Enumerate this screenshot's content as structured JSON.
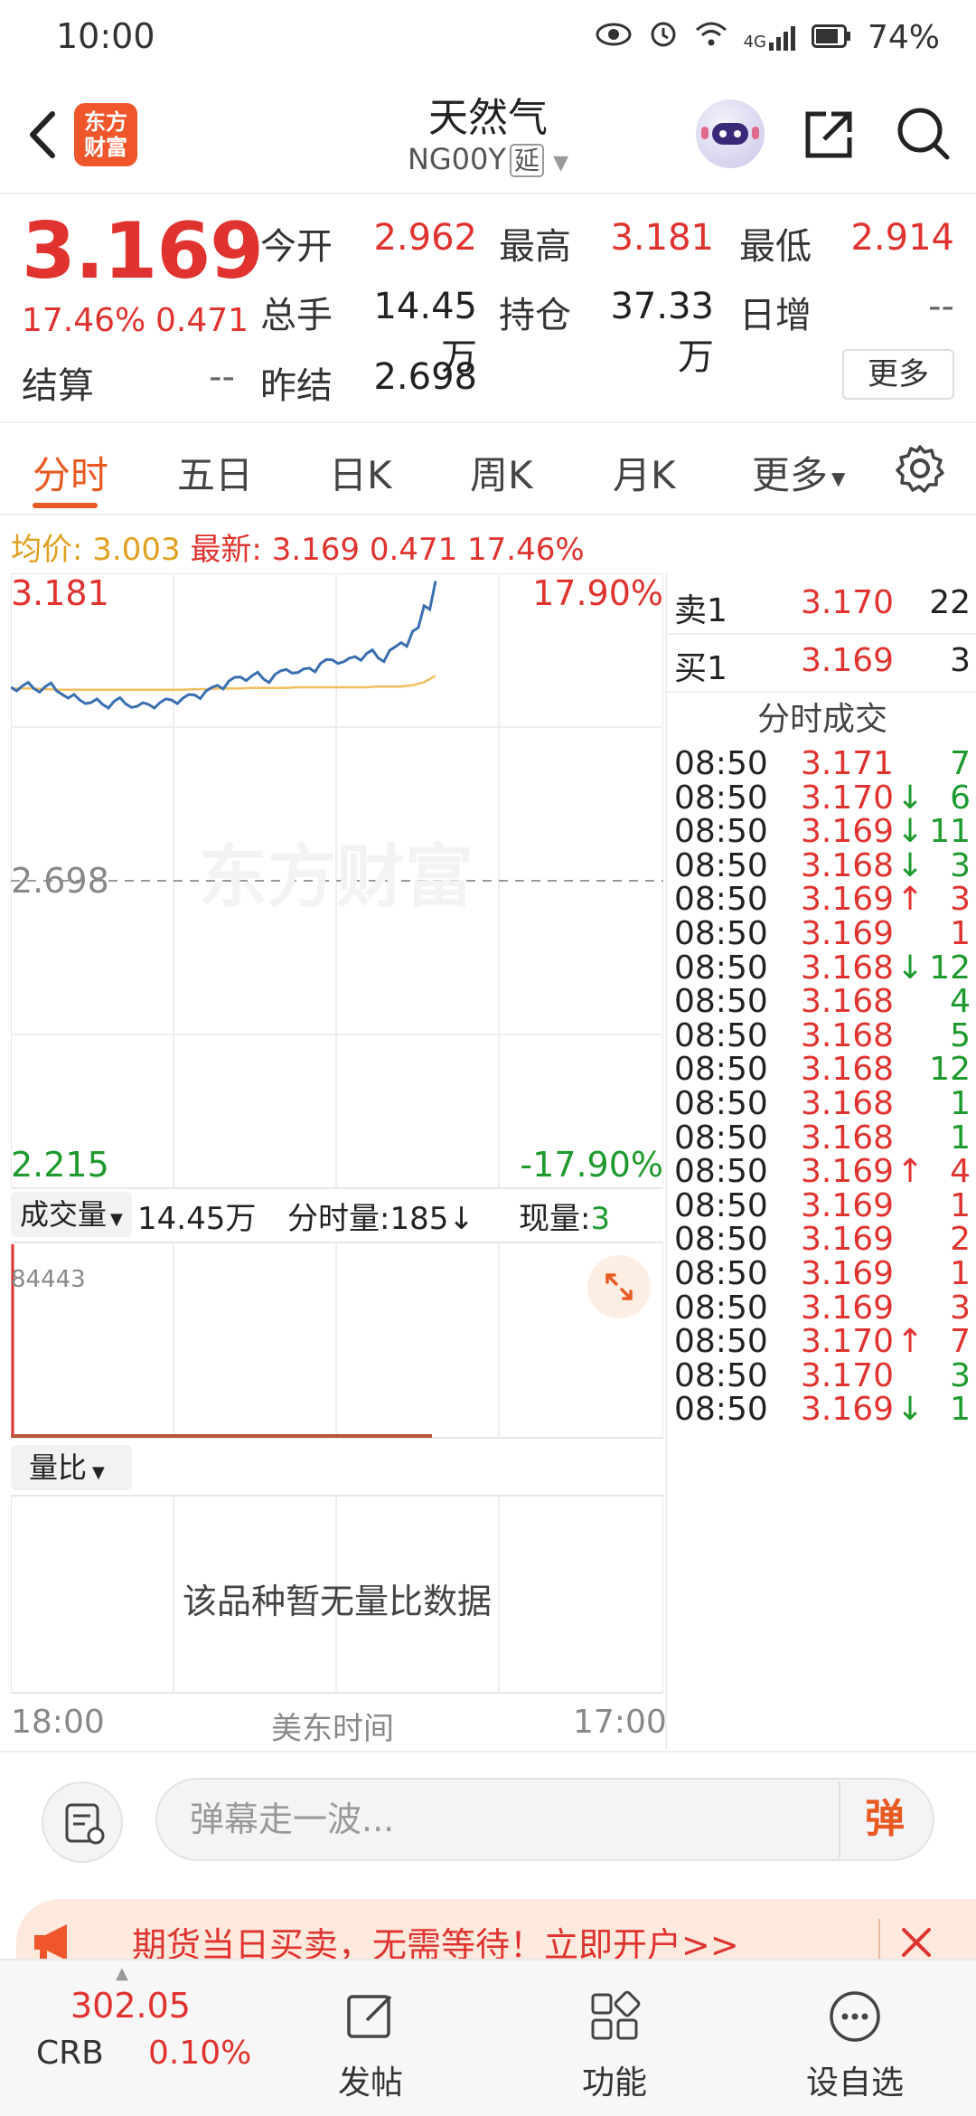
{
  "status_bar": {
    "time": "10:00",
    "network": "4G",
    "battery": "74%"
  },
  "header": {
    "title": "天然气",
    "code": "NG00Y",
    "code_tag": "延",
    "logo_text_1": "东方",
    "logo_text_2": "财富"
  },
  "quote": {
    "price": "3.169",
    "change_pct": "17.46%",
    "change_abs": "0.471",
    "open_label": "今开",
    "open": "2.962",
    "high_label": "最高",
    "high": "3.181",
    "low_label": "最低",
    "low": "2.914",
    "volume_label": "总手",
    "volume": "14.45万",
    "oi_label": "持仓",
    "oi": "37.33万",
    "daily_inc_label": "日增",
    "daily_inc": "--",
    "settle_label": "结算",
    "settle": "--",
    "prev_settle_label": "昨结",
    "prev_settle": "2.698",
    "more": "更多"
  },
  "tabs": [
    "分时",
    "五日",
    "日K",
    "周K",
    "月K",
    "更多"
  ],
  "avg_line": {
    "avg_label": "均价:",
    "avg": "3.003",
    "latest_label": "最新:",
    "latest": "3.169",
    "chg": "0.471",
    "pct": "17.46%"
  },
  "chart": {
    "y_top": "3.181",
    "y_top_pct": "17.90%",
    "y_mid": "2.698",
    "y_bottom": "2.215",
    "y_bottom_pct": "-17.90%",
    "watermark": "东方财富",
    "vol_dropdown": "成交量",
    "vol_total": "14.45万",
    "vol_minute_label": "分时量:",
    "vol_minute": "185",
    "vol_now_label": "现量:",
    "vol_now": "3",
    "vol_max": "84443",
    "ratio_dropdown": "量比",
    "ratio_empty": "该品种暂无量比数据",
    "time_start": "18:00",
    "time_zone": "美东时间",
    "time_end": "17:00"
  },
  "chart_data": {
    "type": "line",
    "title": "",
    "ylim": [
      2.215,
      3.181
    ],
    "prev_close": 2.698,
    "series": [
      {
        "values": [
          3.002,
          3.004,
          3.0,
          3.003,
          2.996,
          2.985,
          2.982,
          2.978,
          2.975,
          2.98,
          2.976,
          2.972,
          2.975,
          2.978,
          2.982,
          2.985,
          2.99,
          2.996,
          3.005,
          3.012,
          3.018,
          3.02,
          3.015,
          3.022,
          3.03,
          3.025,
          3.032,
          3.04,
          3.045,
          3.042,
          3.05,
          3.055,
          3.048,
          3.06,
          3.072,
          3.09,
          3.13,
          3.169
        ]
      },
      {
        "values": [
          3.0,
          3.0,
          3.0,
          2.999,
          2.998,
          2.998,
          2.998,
          2.998,
          2.998,
          2.998,
          2.998,
          2.998,
          2.998,
          2.998,
          2.998,
          2.998,
          2.999,
          2.999,
          3.0,
          3.0,
          3.0,
          3.001,
          3.001,
          3.001,
          3.001,
          3.002,
          3.002,
          3.002,
          3.002,
          3.002,
          3.002,
          3.002,
          3.003,
          3.003,
          3.003,
          3.005,
          3.01,
          3.02
        ]
      }
    ]
  },
  "book": {
    "ask_label": "卖1",
    "ask_price": "3.170",
    "ask_vol": "22",
    "bid_label": "买1",
    "bid_price": "3.169",
    "bid_vol": "3",
    "ticks_title": "分时成交",
    "ticks": [
      {
        "time": "08:50",
        "price": "3.171",
        "dir": "",
        "vol": "7",
        "vcolor": "green"
      },
      {
        "time": "08:50",
        "price": "3.170",
        "dir": "↓",
        "vol": "6",
        "vcolor": "green"
      },
      {
        "time": "08:50",
        "price": "3.169",
        "dir": "↓",
        "vol": "11",
        "vcolor": "green"
      },
      {
        "time": "08:50",
        "price": "3.168",
        "dir": "↓",
        "vol": "3",
        "vcolor": "green"
      },
      {
        "time": "08:50",
        "price": "3.169",
        "dir": "↑",
        "vol": "3",
        "vcolor": "red"
      },
      {
        "time": "08:50",
        "price": "3.169",
        "dir": "",
        "vol": "1",
        "vcolor": "red"
      },
      {
        "time": "08:50",
        "price": "3.168",
        "dir": "↓",
        "vol": "12",
        "vcolor": "green"
      },
      {
        "time": "08:50",
        "price": "3.168",
        "dir": "",
        "vol": "4",
        "vcolor": "green"
      },
      {
        "time": "08:50",
        "price": "3.168",
        "dir": "",
        "vol": "5",
        "vcolor": "green"
      },
      {
        "time": "08:50",
        "price": "3.168",
        "dir": "",
        "vol": "12",
        "vcolor": "green"
      },
      {
        "time": "08:50",
        "price": "3.168",
        "dir": "",
        "vol": "1",
        "vcolor": "green"
      },
      {
        "time": "08:50",
        "price": "3.168",
        "dir": "",
        "vol": "1",
        "vcolor": "green"
      },
      {
        "time": "08:50",
        "price": "3.169",
        "dir": "↑",
        "vol": "4",
        "vcolor": "red"
      },
      {
        "time": "08:50",
        "price": "3.169",
        "dir": "",
        "vol": "1",
        "vcolor": "red"
      },
      {
        "time": "08:50",
        "price": "3.169",
        "dir": "",
        "vol": "2",
        "vcolor": "red"
      },
      {
        "time": "08:50",
        "price": "3.169",
        "dir": "",
        "vol": "1",
        "vcolor": "red"
      },
      {
        "time": "08:50",
        "price": "3.169",
        "dir": "",
        "vol": "3",
        "vcolor": "red"
      },
      {
        "time": "08:50",
        "price": "3.170",
        "dir": "↑",
        "vol": "7",
        "vcolor": "red"
      },
      {
        "time": "08:50",
        "price": "3.170",
        "dir": "",
        "vol": "3",
        "vcolor": "green"
      },
      {
        "time": "08:50",
        "price": "3.169",
        "dir": "↓",
        "vol": "1",
        "vcolor": "green"
      }
    ]
  },
  "comment": {
    "placeholder": "弹幕走一波...",
    "danmu": "弹"
  },
  "promo": {
    "text": "期货当日买卖，无需等待！立即开户>>"
  },
  "bottom_nav": {
    "index_value": "302.05",
    "index_name": "CRB",
    "index_pct": "0.10%",
    "post": "发帖",
    "function": "功能",
    "watchlist": "设自选"
  },
  "colors": {
    "up": "#e0332f",
    "down": "#1e9a2e",
    "accent": "#e85a21",
    "price_line": "#3a6fb0",
    "avg_line": "#f0c060"
  }
}
